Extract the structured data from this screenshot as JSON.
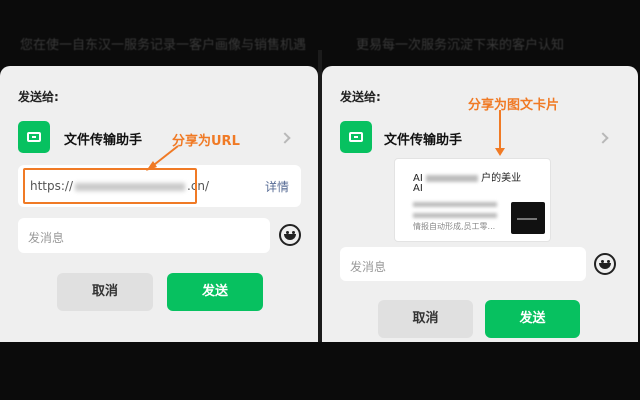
{
  "background_text": {
    "left": "您在使一自东汉一服务记录一客户画像与销售机遇",
    "right": "更易每一次服务沉淀下来的客户认知"
  },
  "left_panel": {
    "send_to_label": "发送给:",
    "contact_name": "文件传输助手",
    "annotation": "分享为URL",
    "url_prefix": "https://",
    "url_suffix": ".cn/",
    "detail_link": "详情",
    "message_placeholder": "发消息",
    "cancel_label": "取消",
    "send_label": "发送"
  },
  "right_panel": {
    "send_to_label": "发送给:",
    "contact_name": "文件传输助手",
    "annotation": "分享为图文卡片",
    "card_title_prefix": "AI",
    "card_title_suffix": "户的美业",
    "card_title_line2": "AI",
    "card_desc_line1": "",
    "card_desc_line2": "",
    "card_desc_line3": "情报自动形成,员工零...",
    "message_placeholder": "发消息",
    "cancel_label": "取消",
    "send_label": "发送"
  },
  "colors": {
    "accent": "#07c160",
    "annotation": "#f07a25",
    "link": "#576b95"
  },
  "icons": {
    "app": "file-transfer-icon",
    "chevron": "chevron-right-icon",
    "emoji": "emoji-icon"
  }
}
